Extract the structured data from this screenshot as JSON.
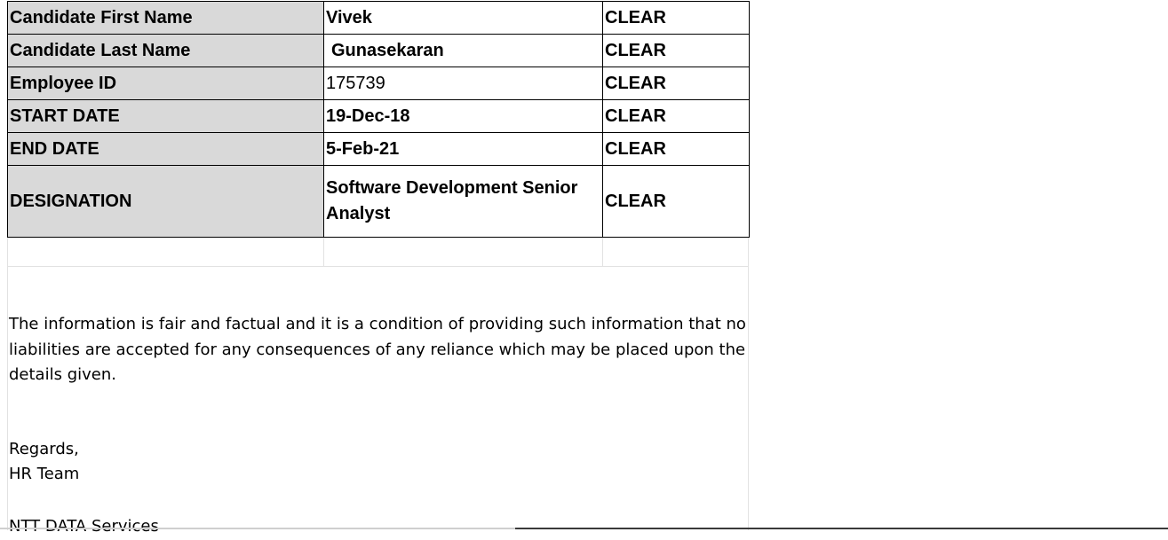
{
  "table": {
    "rows": [
      {
        "label": "Candidate First Name",
        "value": "Vivek",
        "status": "CLEAR"
      },
      {
        "label": "Candidate Last Name",
        "value": "Gunasekaran",
        "status": "CLEAR"
      },
      {
        "label": "Employee ID",
        "value": "175739",
        "status": "CLEAR"
      },
      {
        "label": "START DATE",
        "value": "19-Dec-18",
        "status": "CLEAR"
      },
      {
        "label": "END DATE",
        "value": "5-Feb-21",
        "status": "CLEAR"
      },
      {
        "label": "DESIGNATION",
        "value": "Software Development Senior Analyst",
        "status": "CLEAR"
      }
    ]
  },
  "disclaimer": "The information is fair and factual and it is a condition of providing such information that no liabilities are accepted for any consequences of any reliance which may be placed upon the details given.",
  "closing": {
    "greeting": "Regards,",
    "signoff": "HR Team",
    "company": "NTT DATA Services"
  },
  "colors": {
    "label_fill": "#d9d9d9",
    "gridline": "#e2e2e2",
    "border": "#000000"
  }
}
